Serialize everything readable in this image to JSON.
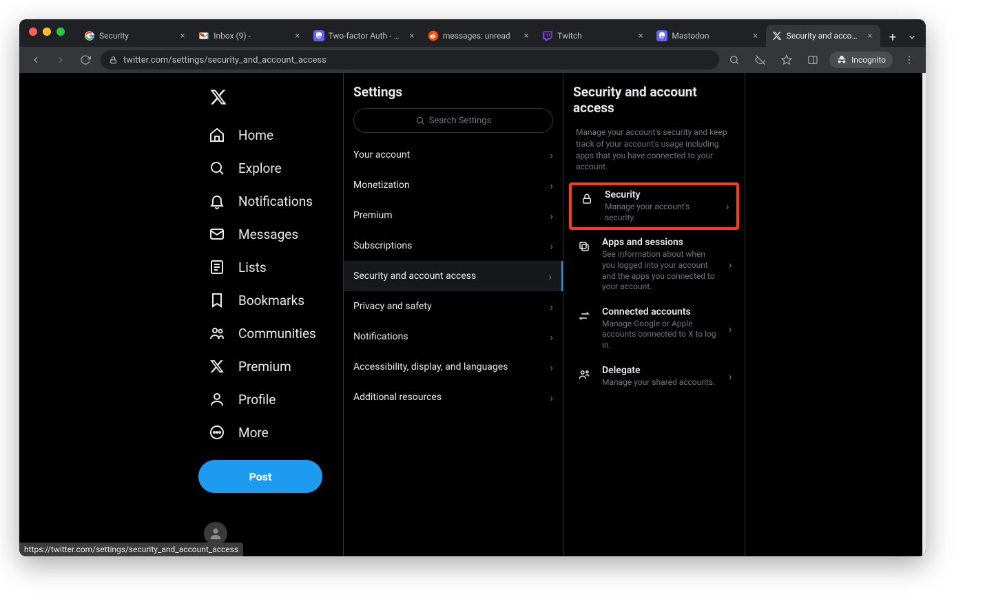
{
  "browser": {
    "tabs": [
      {
        "favicon": "google",
        "title": "Security"
      },
      {
        "favicon": "gmail",
        "title": "Inbox (9) - "
      },
      {
        "favicon": "mastodon",
        "title": "Two-factor Auth - Masto…"
      },
      {
        "favicon": "reddit",
        "title": "messages: unread"
      },
      {
        "favicon": "twitch",
        "title": "Twitch"
      },
      {
        "favicon": "mastodon",
        "title": "Mastodon"
      },
      {
        "favicon": "x",
        "title": "Security and account acc",
        "active": true
      }
    ],
    "url": "twitter.com/settings/security_and_account_access",
    "incognito_label": "Incognito",
    "status_url": "https://twitter.com/settings/security_and_account_access"
  },
  "nav": {
    "items": [
      {
        "icon": "home",
        "label": "Home"
      },
      {
        "icon": "search",
        "label": "Explore"
      },
      {
        "icon": "bell",
        "label": "Notifications"
      },
      {
        "icon": "mail",
        "label": "Messages"
      },
      {
        "icon": "list",
        "label": "Lists"
      },
      {
        "icon": "bookmark",
        "label": "Bookmarks"
      },
      {
        "icon": "communities",
        "label": "Communities"
      },
      {
        "icon": "x",
        "label": "Premium"
      },
      {
        "icon": "profile",
        "label": "Profile"
      },
      {
        "icon": "more",
        "label": "More"
      }
    ],
    "post_label": "Post"
  },
  "settings": {
    "title": "Settings",
    "search_placeholder": "Search Settings",
    "items": [
      "Your account",
      "Monetization",
      "Premium",
      "Subscriptions",
      "Security and account access",
      "Privacy and safety",
      "Notifications",
      "Accessibility, display, and languages",
      "Additional resources"
    ],
    "active_index": 4
  },
  "detail": {
    "title": "Security and account access",
    "subtitle": "Manage your account's security and keep track of your account's usage including apps that you have connected to your account.",
    "items": [
      {
        "icon": "lock",
        "title": "Security",
        "desc": "Manage your account's security.",
        "highlight": true
      },
      {
        "icon": "apps",
        "title": "Apps and sessions",
        "desc": "See information about when you logged into your account and the apps you connected to your account."
      },
      {
        "icon": "swap",
        "title": "Connected accounts",
        "desc": "Manage Google or Apple accounts connected to X to log in."
      },
      {
        "icon": "delegate",
        "title": "Delegate",
        "desc": "Manage your shared accounts."
      }
    ]
  }
}
